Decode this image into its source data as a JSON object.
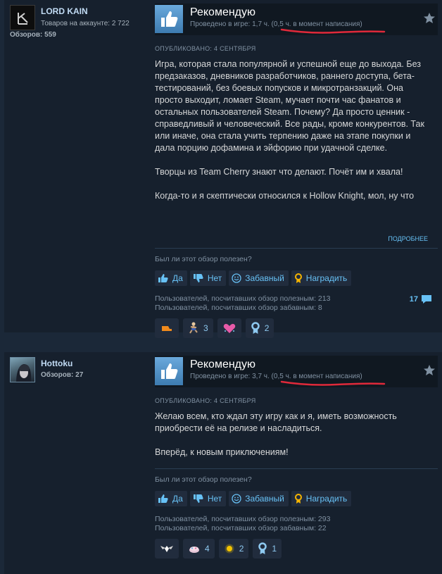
{
  "reviews": [
    {
      "author": "LORD KAIN",
      "products": "Товаров на аккаунте: 2 722",
      "reviews_count": "Обзоров: 559",
      "verdict": "Рекомендую",
      "hours": "Проведено в игре: 1,7 ч. (0,5 ч. в момент написания)",
      "posted": "ОПУБЛИКОВАНО: 4 СЕНТЯБРЯ",
      "paragraphs": [
        "Игра, которая стала популярной и успешной еще до выхода. Без предзаказов, дневников разработчиков, раннего доступа, бета-тестирований, без боевых попусков и микротранзакций. Она просто выходит, ломает Steam, мучает почти час фанатов и остальных пользователей Steam. Почему? Да просто ценник - справедливый и человеческий. Все рады, кроме конкурентов. Так или иначе, она стала учить терпению даже на этапе покупки и дала порцию дофамина и эйфорию при удачной сделке.",
        "Творцы из Team Cherry знают что делают. Почёт им и хвала!",
        "Когда-то и я скептически относился к Hollow Knight, мол, ну что"
      ],
      "read_more": "ПОДРОБНЕЕ",
      "helpful_question": "Был ли этот обзор полезен?",
      "buttons": {
        "yes": "Да",
        "no": "Нет",
        "funny": "Забавный",
        "award": "Наградить"
      },
      "stats": [
        "Пользователей, посчитавших обзор полезным: 213",
        "Пользователей, посчитавших обзор забавным: 8"
      ],
      "comments": "17",
      "awards": [
        {
          "icon": "orange-boot-icon",
          "count": ""
        },
        {
          "icon": "dancing-figure-icon",
          "count": "3"
        },
        {
          "icon": "pink-heart-icon",
          "count": ""
        },
        {
          "icon": "ribbon-medal-icon",
          "count": "2"
        }
      ]
    },
    {
      "author": "Hottoku",
      "products": "",
      "reviews_count": "Обзоров: 27",
      "verdict": "Рекомендую",
      "hours": "Проведено в игре: 3,7 ч. (0,5 ч. в момент написания)",
      "posted": "ОПУБЛИКОВАНО: 4 СЕНТЯБРЯ",
      "paragraphs": [
        "Желаю всем, кто ждал эту игру как и я, иметь возможность приобрести её на релизе и насладиться.",
        "Вперёд, к новым приключениям!"
      ],
      "helpful_question": "Был ли этот обзор полезен?",
      "buttons": {
        "yes": "Да",
        "no": "Нет",
        "funny": "Забавный",
        "award": "Наградить"
      },
      "stats": [
        "Пользователей, посчитавших обзор полезным: 293",
        "Пользователей, посчитавших обзор забавным: 22"
      ],
      "awards": [
        {
          "icon": "winged-emblem-icon",
          "count": ""
        },
        {
          "icon": "cake-icon",
          "count": "4"
        },
        {
          "icon": "sparkle-icon",
          "count": "2"
        },
        {
          "icon": "ribbon-medal-icon",
          "count": "1"
        }
      ]
    }
  ],
  "colors": {
    "accent": "#67c1f5",
    "underline": "#e0293a",
    "thumb": "#4b8bc2"
  }
}
